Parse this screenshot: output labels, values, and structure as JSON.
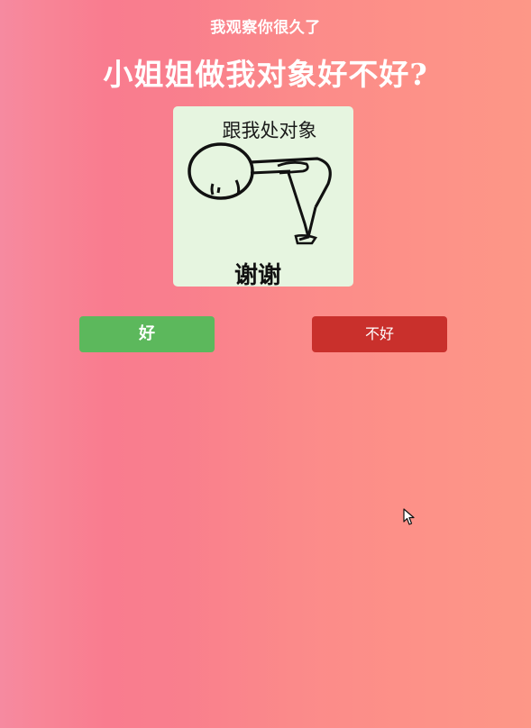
{
  "subtitle": "我观察你很久了",
  "headline": "小姐姐做我对象好不好?",
  "meme": {
    "caption_top": "跟我处对象",
    "caption_bottom": "谢谢"
  },
  "buttons": {
    "yes_label": "好",
    "no_label": "不好"
  },
  "colors": {
    "yes_button": "#5cb85c",
    "no_button": "#c9302c",
    "meme_background": "#e6f5e0"
  }
}
